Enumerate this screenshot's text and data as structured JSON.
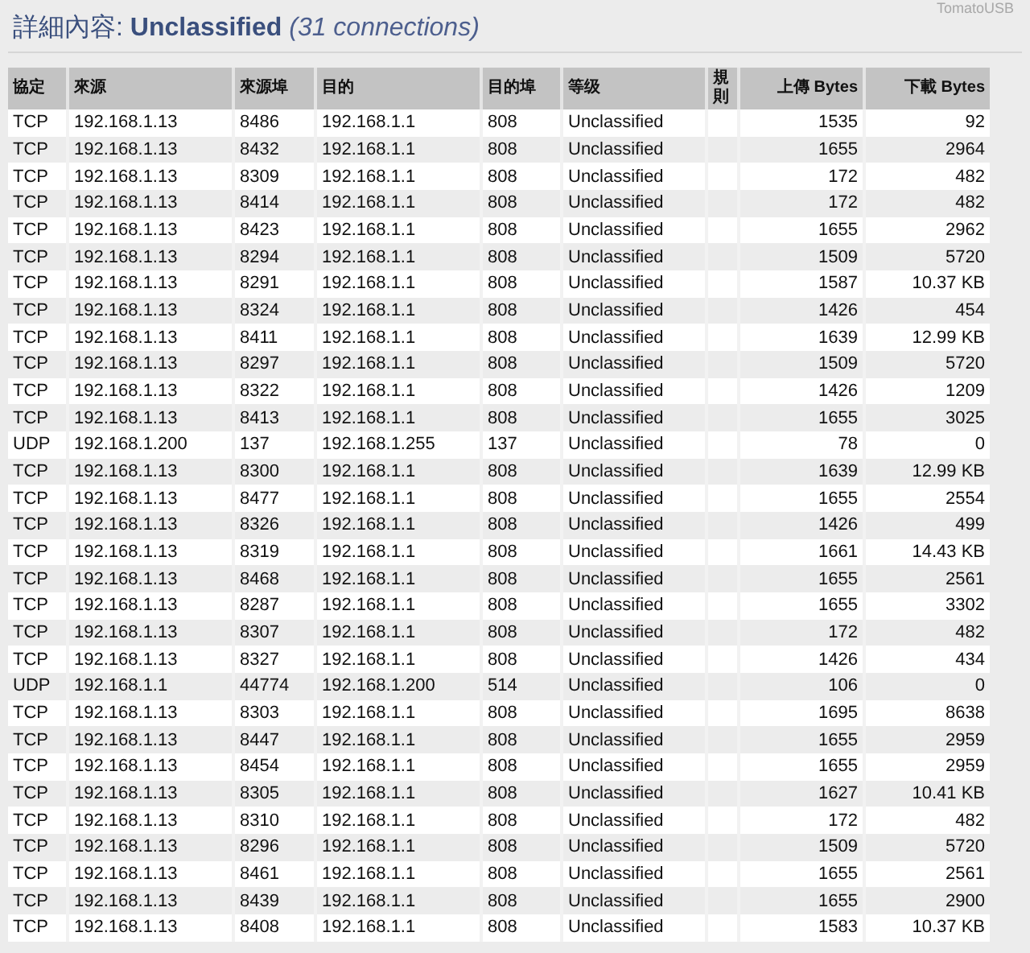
{
  "brand": "TomatoUSB",
  "title": "詳細內容: **Unclassified** *(31 connections)*",
  "table": {
    "columns": [
      {
        "label": "協定",
        "kind": "text"
      },
      {
        "label": "來源",
        "kind": "text"
      },
      {
        "label": "來源埠",
        "kind": "text"
      },
      {
        "label": "目的",
        "kind": "text"
      },
      {
        "label": "目的埠",
        "kind": "text"
      },
      {
        "label": "等级",
        "kind": "text"
      },
      {
        "label": "規則",
        "kind": "text"
      },
      {
        "label": "上傳 Bytes",
        "kind": "number"
      },
      {
        "label": "下載 Bytes",
        "kind": "number"
      }
    ],
    "rows": [
      [
        "TCP",
        "192.168.1.13",
        "8486",
        "192.168.1.1",
        "808",
        "Unclassified",
        "",
        "1535",
        "92"
      ],
      [
        "TCP",
        "192.168.1.13",
        "8432",
        "192.168.1.1",
        "808",
        "Unclassified",
        "",
        "1655",
        "2964"
      ],
      [
        "TCP",
        "192.168.1.13",
        "8309",
        "192.168.1.1",
        "808",
        "Unclassified",
        "",
        "172",
        "482"
      ],
      [
        "TCP",
        "192.168.1.13",
        "8414",
        "192.168.1.1",
        "808",
        "Unclassified",
        "",
        "172",
        "482"
      ],
      [
        "TCP",
        "192.168.1.13",
        "8423",
        "192.168.1.1",
        "808",
        "Unclassified",
        "",
        "1655",
        "2962"
      ],
      [
        "TCP",
        "192.168.1.13",
        "8294",
        "192.168.1.1",
        "808",
        "Unclassified",
        "",
        "1509",
        "5720"
      ],
      [
        "TCP",
        "192.168.1.13",
        "8291",
        "192.168.1.1",
        "808",
        "Unclassified",
        "",
        "1587",
        "10.37 KB"
      ],
      [
        "TCP",
        "192.168.1.13",
        "8324",
        "192.168.1.1",
        "808",
        "Unclassified",
        "",
        "1426",
        "454"
      ],
      [
        "TCP",
        "192.168.1.13",
        "8411",
        "192.168.1.1",
        "808",
        "Unclassified",
        "",
        "1639",
        "12.99 KB"
      ],
      [
        "TCP",
        "192.168.1.13",
        "8297",
        "192.168.1.1",
        "808",
        "Unclassified",
        "",
        "1509",
        "5720"
      ],
      [
        "TCP",
        "192.168.1.13",
        "8322",
        "192.168.1.1",
        "808",
        "Unclassified",
        "",
        "1426",
        "1209"
      ],
      [
        "TCP",
        "192.168.1.13",
        "8413",
        "192.168.1.1",
        "808",
        "Unclassified",
        "",
        "1655",
        "3025"
      ],
      [
        "UDP",
        "192.168.1.200",
        "137",
        "192.168.1.255",
        "137",
        "Unclassified",
        "",
        "78",
        "0"
      ],
      [
        "TCP",
        "192.168.1.13",
        "8300",
        "192.168.1.1",
        "808",
        "Unclassified",
        "",
        "1639",
        "12.99 KB"
      ],
      [
        "TCP",
        "192.168.1.13",
        "8477",
        "192.168.1.1",
        "808",
        "Unclassified",
        "",
        "1655",
        "2554"
      ],
      [
        "TCP",
        "192.168.1.13",
        "8326",
        "192.168.1.1",
        "808",
        "Unclassified",
        "",
        "1426",
        "499"
      ],
      [
        "TCP",
        "192.168.1.13",
        "8319",
        "192.168.1.1",
        "808",
        "Unclassified",
        "",
        "1661",
        "14.43 KB"
      ],
      [
        "TCP",
        "192.168.1.13",
        "8468",
        "192.168.1.1",
        "808",
        "Unclassified",
        "",
        "1655",
        "2561"
      ],
      [
        "TCP",
        "192.168.1.13",
        "8287",
        "192.168.1.1",
        "808",
        "Unclassified",
        "",
        "1655",
        "3302"
      ],
      [
        "TCP",
        "192.168.1.13",
        "8307",
        "192.168.1.1",
        "808",
        "Unclassified",
        "",
        "172",
        "482"
      ],
      [
        "TCP",
        "192.168.1.13",
        "8327",
        "192.168.1.1",
        "808",
        "Unclassified",
        "",
        "1426",
        "434"
      ],
      [
        "UDP",
        "192.168.1.1",
        "44774",
        "192.168.1.200",
        "514",
        "Unclassified",
        "",
        "106",
        "0"
      ],
      [
        "TCP",
        "192.168.1.13",
        "8303",
        "192.168.1.1",
        "808",
        "Unclassified",
        "",
        "1695",
        "8638"
      ],
      [
        "TCP",
        "192.168.1.13",
        "8447",
        "192.168.1.1",
        "808",
        "Unclassified",
        "",
        "1655",
        "2959"
      ],
      [
        "TCP",
        "192.168.1.13",
        "8454",
        "192.168.1.1",
        "808",
        "Unclassified",
        "",
        "1655",
        "2959"
      ],
      [
        "TCP",
        "192.168.1.13",
        "8305",
        "192.168.1.1",
        "808",
        "Unclassified",
        "",
        "1627",
        "10.41 KB"
      ],
      [
        "TCP",
        "192.168.1.13",
        "8310",
        "192.168.1.1",
        "808",
        "Unclassified",
        "",
        "172",
        "482"
      ],
      [
        "TCP",
        "192.168.1.13",
        "8296",
        "192.168.1.1",
        "808",
        "Unclassified",
        "",
        "1509",
        "5720"
      ],
      [
        "TCP",
        "192.168.1.13",
        "8461",
        "192.168.1.1",
        "808",
        "Unclassified",
        "",
        "1655",
        "2561"
      ],
      [
        "TCP",
        "192.168.1.13",
        "8439",
        "192.168.1.1",
        "808",
        "Unclassified",
        "",
        "1655",
        "2900"
      ],
      [
        "TCP",
        "192.168.1.13",
        "8408",
        "192.168.1.1",
        "808",
        "Unclassified",
        "",
        "1583",
        "10.37 KB"
      ]
    ]
  }
}
